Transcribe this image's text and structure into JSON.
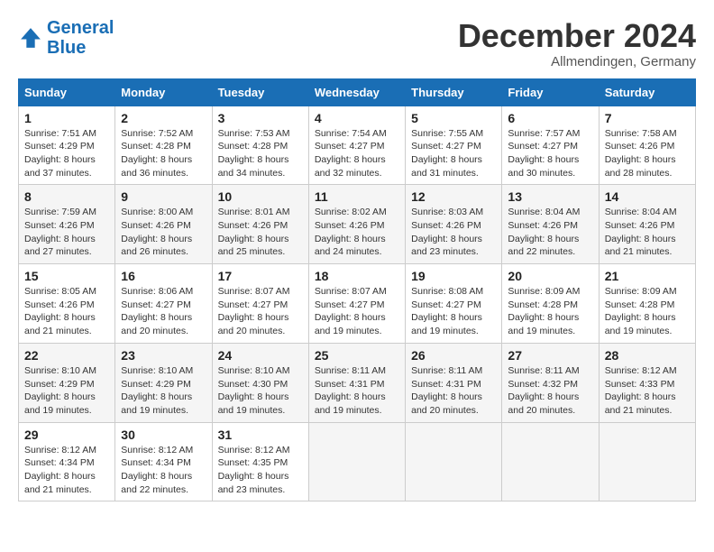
{
  "header": {
    "logo_line1": "General",
    "logo_line2": "Blue",
    "month": "December 2024",
    "location": "Allmendingen, Germany"
  },
  "days_of_week": [
    "Sunday",
    "Monday",
    "Tuesday",
    "Wednesday",
    "Thursday",
    "Friday",
    "Saturday"
  ],
  "weeks": [
    [
      {
        "day": 1,
        "sunrise": "7:51 AM",
        "sunset": "4:29 PM",
        "daylight": "8 hours and 37 minutes."
      },
      {
        "day": 2,
        "sunrise": "7:52 AM",
        "sunset": "4:28 PM",
        "daylight": "8 hours and 36 minutes."
      },
      {
        "day": 3,
        "sunrise": "7:53 AM",
        "sunset": "4:28 PM",
        "daylight": "8 hours and 34 minutes."
      },
      {
        "day": 4,
        "sunrise": "7:54 AM",
        "sunset": "4:27 PM",
        "daylight": "8 hours and 32 minutes."
      },
      {
        "day": 5,
        "sunrise": "7:55 AM",
        "sunset": "4:27 PM",
        "daylight": "8 hours and 31 minutes."
      },
      {
        "day": 6,
        "sunrise": "7:57 AM",
        "sunset": "4:27 PM",
        "daylight": "8 hours and 30 minutes."
      },
      {
        "day": 7,
        "sunrise": "7:58 AM",
        "sunset": "4:26 PM",
        "daylight": "8 hours and 28 minutes."
      }
    ],
    [
      {
        "day": 8,
        "sunrise": "7:59 AM",
        "sunset": "4:26 PM",
        "daylight": "8 hours and 27 minutes."
      },
      {
        "day": 9,
        "sunrise": "8:00 AM",
        "sunset": "4:26 PM",
        "daylight": "8 hours and 26 minutes."
      },
      {
        "day": 10,
        "sunrise": "8:01 AM",
        "sunset": "4:26 PM",
        "daylight": "8 hours and 25 minutes."
      },
      {
        "day": 11,
        "sunrise": "8:02 AM",
        "sunset": "4:26 PM",
        "daylight": "8 hours and 24 minutes."
      },
      {
        "day": 12,
        "sunrise": "8:03 AM",
        "sunset": "4:26 PM",
        "daylight": "8 hours and 23 minutes."
      },
      {
        "day": 13,
        "sunrise": "8:04 AM",
        "sunset": "4:26 PM",
        "daylight": "8 hours and 22 minutes."
      },
      {
        "day": 14,
        "sunrise": "8:04 AM",
        "sunset": "4:26 PM",
        "daylight": "8 hours and 21 minutes."
      }
    ],
    [
      {
        "day": 15,
        "sunrise": "8:05 AM",
        "sunset": "4:26 PM",
        "daylight": "8 hours and 21 minutes."
      },
      {
        "day": 16,
        "sunrise": "8:06 AM",
        "sunset": "4:27 PM",
        "daylight": "8 hours and 20 minutes."
      },
      {
        "day": 17,
        "sunrise": "8:07 AM",
        "sunset": "4:27 PM",
        "daylight": "8 hours and 20 minutes."
      },
      {
        "day": 18,
        "sunrise": "8:07 AM",
        "sunset": "4:27 PM",
        "daylight": "8 hours and 19 minutes."
      },
      {
        "day": 19,
        "sunrise": "8:08 AM",
        "sunset": "4:27 PM",
        "daylight": "8 hours and 19 minutes."
      },
      {
        "day": 20,
        "sunrise": "8:09 AM",
        "sunset": "4:28 PM",
        "daylight": "8 hours and 19 minutes."
      },
      {
        "day": 21,
        "sunrise": "8:09 AM",
        "sunset": "4:28 PM",
        "daylight": "8 hours and 19 minutes."
      }
    ],
    [
      {
        "day": 22,
        "sunrise": "8:10 AM",
        "sunset": "4:29 PM",
        "daylight": "8 hours and 19 minutes."
      },
      {
        "day": 23,
        "sunrise": "8:10 AM",
        "sunset": "4:29 PM",
        "daylight": "8 hours and 19 minutes."
      },
      {
        "day": 24,
        "sunrise": "8:10 AM",
        "sunset": "4:30 PM",
        "daylight": "8 hours and 19 minutes."
      },
      {
        "day": 25,
        "sunrise": "8:11 AM",
        "sunset": "4:31 PM",
        "daylight": "8 hours and 19 minutes."
      },
      {
        "day": 26,
        "sunrise": "8:11 AM",
        "sunset": "4:31 PM",
        "daylight": "8 hours and 20 minutes."
      },
      {
        "day": 27,
        "sunrise": "8:11 AM",
        "sunset": "4:32 PM",
        "daylight": "8 hours and 20 minutes."
      },
      {
        "day": 28,
        "sunrise": "8:12 AM",
        "sunset": "4:33 PM",
        "daylight": "8 hours and 21 minutes."
      }
    ],
    [
      {
        "day": 29,
        "sunrise": "8:12 AM",
        "sunset": "4:34 PM",
        "daylight": "8 hours and 21 minutes."
      },
      {
        "day": 30,
        "sunrise": "8:12 AM",
        "sunset": "4:34 PM",
        "daylight": "8 hours and 22 minutes."
      },
      {
        "day": 31,
        "sunrise": "8:12 AM",
        "sunset": "4:35 PM",
        "daylight": "8 hours and 23 minutes."
      },
      null,
      null,
      null,
      null
    ]
  ]
}
